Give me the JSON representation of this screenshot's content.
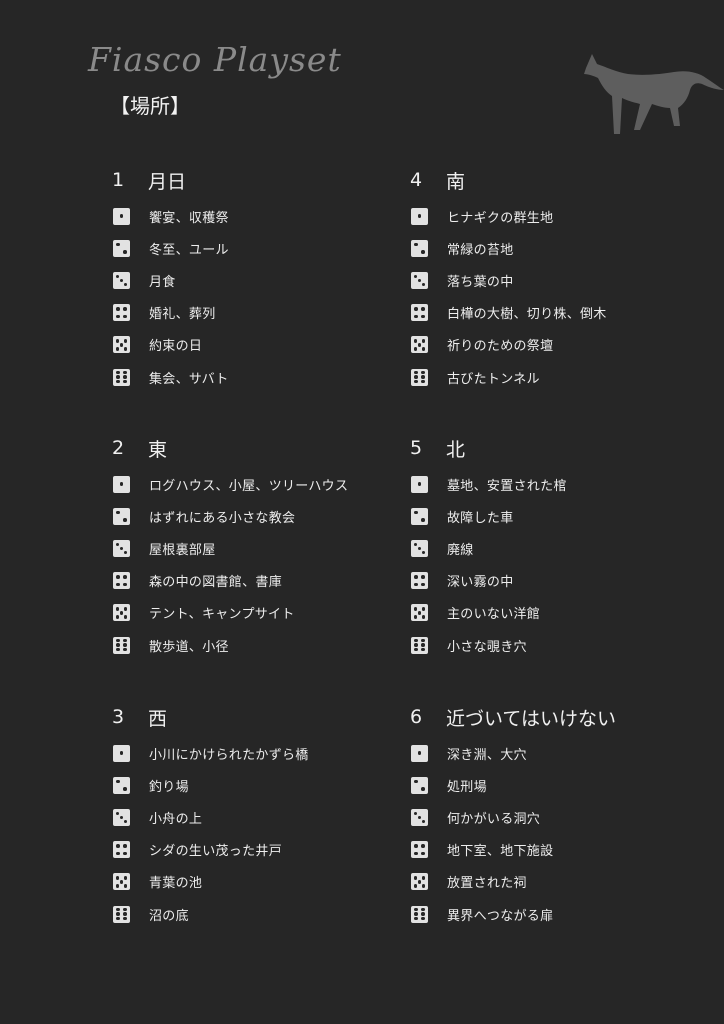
{
  "header": {
    "brand": "Fiasco Playset",
    "title": "【場所】"
  },
  "sections": [
    {
      "number": "1",
      "title": "月日",
      "items": [
        "饗宴、収穫祭",
        "冬至、ユール",
        "月食",
        "婚礼、葬列",
        "約束の日",
        "集会、サバト"
      ]
    },
    {
      "number": "2",
      "title": "東",
      "items": [
        "ログハウス、小屋、ツリーハウス",
        "はずれにある小さな教会",
        "屋根裏部屋",
        "森の中の図書館、書庫",
        "テント、キャンプサイト",
        "散歩道、小径"
      ]
    },
    {
      "number": "3",
      "title": "西",
      "items": [
        "小川にかけられたかずら橋",
        "釣り場",
        "小舟の上",
        "シダの生い茂った井戸",
        "青葉の池",
        "沼の底"
      ]
    },
    {
      "number": "4",
      "title": "南",
      "items": [
        "ヒナギクの群生地",
        "常緑の苔地",
        "落ち葉の中",
        "白樺の大樹、切り株、倒木",
        "祈りのための祭壇",
        "古びたトンネル"
      ]
    },
    {
      "number": "5",
      "title": "北",
      "items": [
        "墓地、安置された棺",
        "故障した車",
        "廃線",
        "深い霧の中",
        "主のいない洋館",
        "小さな覗き穴"
      ]
    },
    {
      "number": "6",
      "title": "近づいてはいけない",
      "items": [
        "深き淵、大穴",
        "処刑場",
        "何かがいる洞穴",
        "地下室、地下施設",
        "放置された祠",
        "異界へつながる扉"
      ]
    }
  ],
  "icons": {
    "die": "die-face-icon",
    "decoration": "cat-silhouette-icon"
  },
  "colors": {
    "background": "#262626",
    "text": "#eeeeee",
    "die": "#e2e2e2",
    "brand": "#8a8a8a",
    "cat": "#5e5e5e"
  }
}
